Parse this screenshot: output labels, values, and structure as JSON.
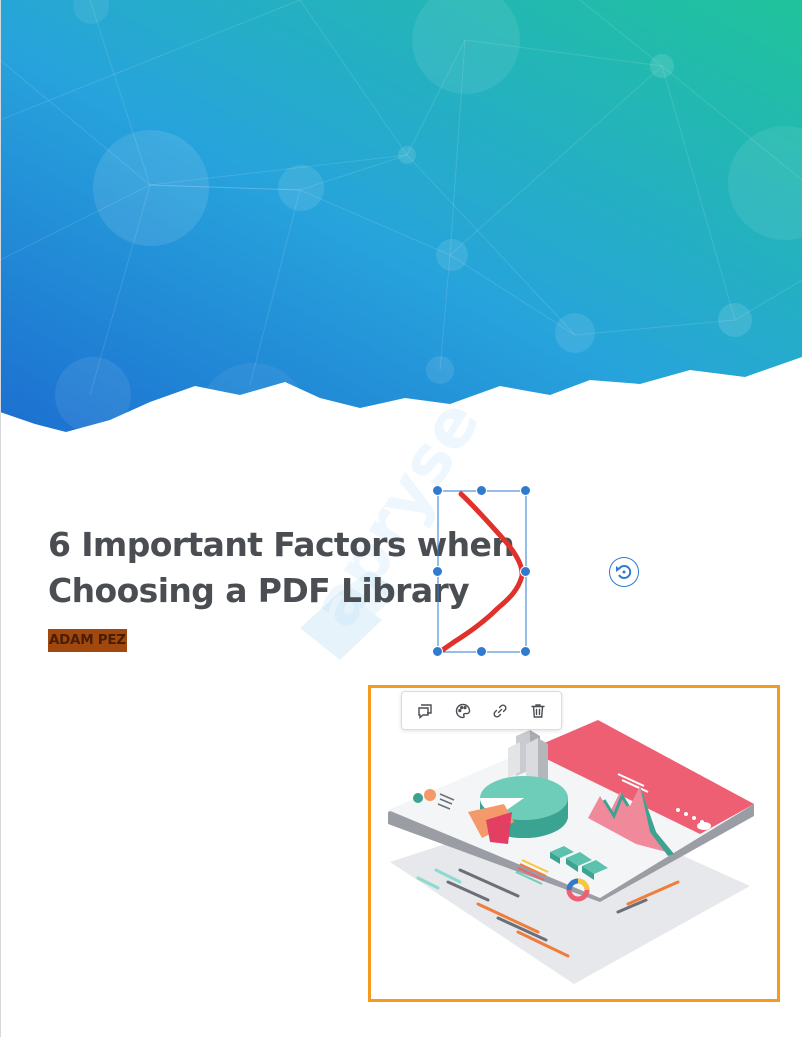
{
  "document": {
    "title_line1": "6 Important Factors when",
    "title_line2": "Choosing a PDF Library",
    "author": "ADAM PEZ",
    "watermark_text": "apryse"
  },
  "annotation_toolbar": {
    "icons": [
      "comment-icon",
      "palette-icon",
      "link-icon",
      "trash-icon"
    ]
  },
  "colors": {
    "hero_gradient_start": "#1e7dd3",
    "hero_gradient_end": "#1fbf9f",
    "title_text": "#4a4d51",
    "author_highlight": "#a0480d",
    "ink_stroke": "#e0322a",
    "selection_blue": "#2e7bd0",
    "image_selection_border": "#f39a1f"
  }
}
